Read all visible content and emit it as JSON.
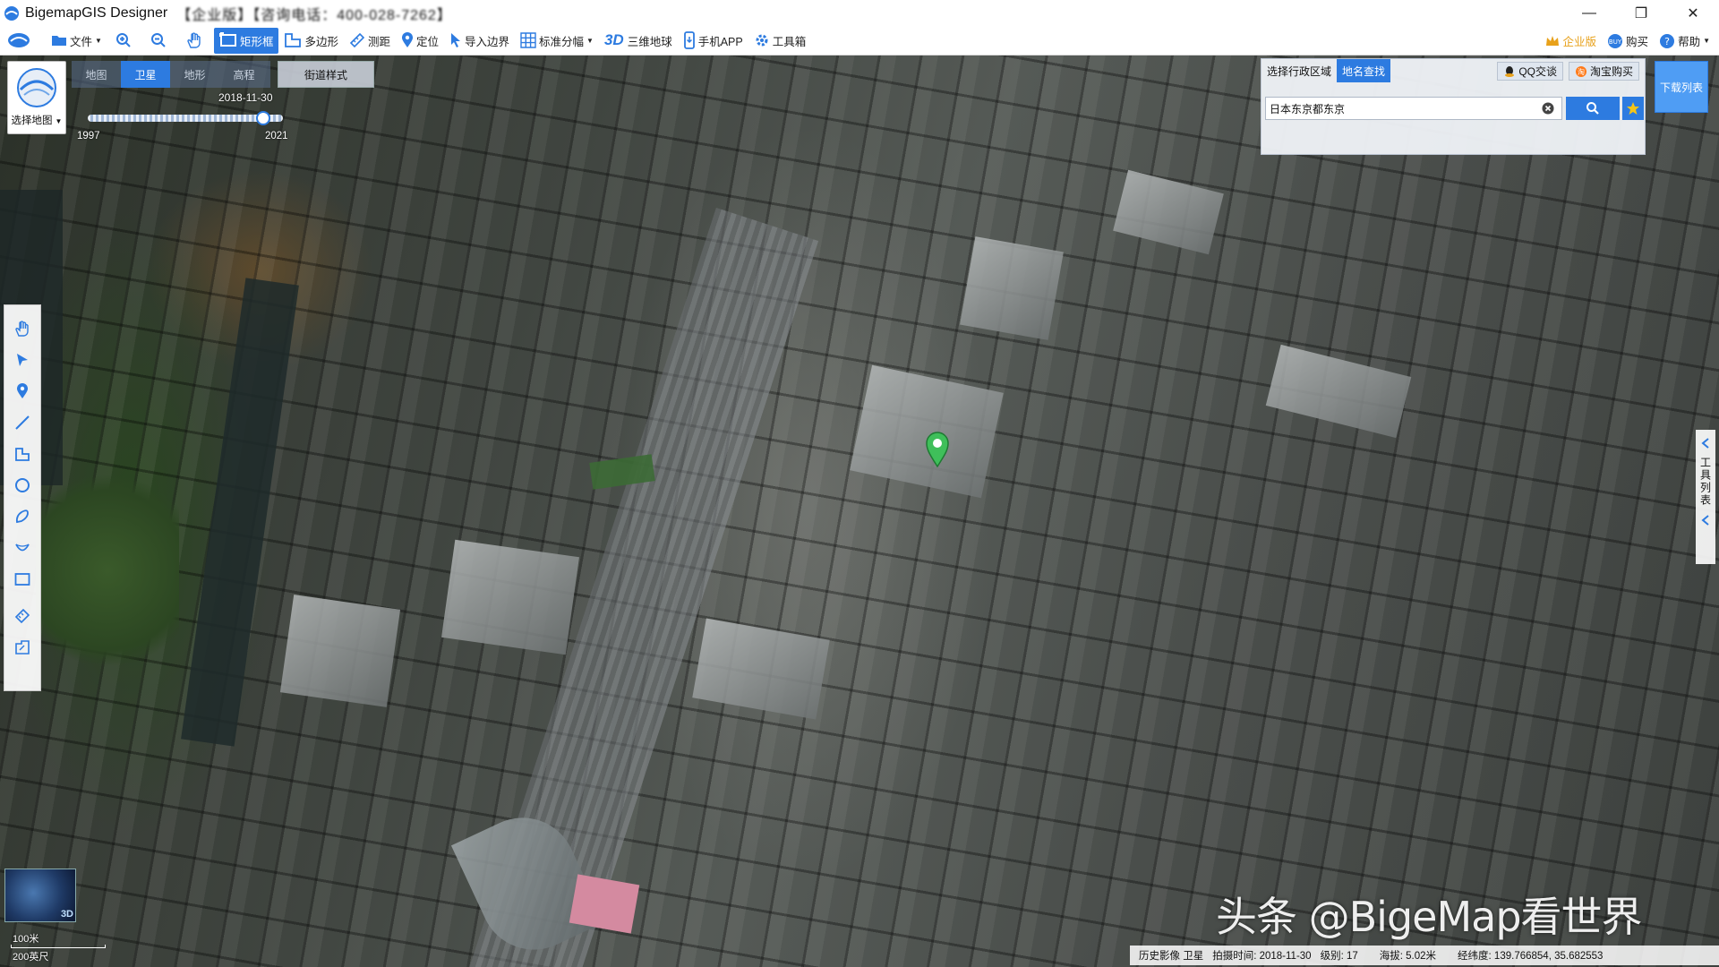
{
  "window": {
    "title": "BigemapGIS Designer",
    "title_extra": "【企业版】【咨询电话：400-028-7262】",
    "controls": [
      "—",
      "❐",
      "✕"
    ]
  },
  "toolbar": {
    "file": "文件",
    "rect_select": "矩形框",
    "polygon": "多边形",
    "measure": "测距",
    "locate": "定位",
    "import_boundary": "导入边界",
    "standard_tiles": "标准分幅",
    "three_d": "3D",
    "globe3d": "三维地球",
    "mobile_app": "手机APP",
    "toolbox": "工具箱",
    "enterprise": "企业版",
    "buy": "购买",
    "help": "帮助"
  },
  "basemap": {
    "select_label": "选择地图",
    "types": [
      {
        "label": "地图",
        "active": false
      },
      {
        "label": "卫星",
        "active": true
      },
      {
        "label": "地形",
        "active": false
      },
      {
        "label": "高程",
        "active": false
      }
    ],
    "street_style": "街道样式"
  },
  "timeline": {
    "current_date": "2018-11-30",
    "start_year": "1997",
    "end_year": "2021"
  },
  "search_panel": {
    "tabs": [
      {
        "label": "选择行政区域",
        "active": false
      },
      {
        "label": "地名查找",
        "active": true
      }
    ],
    "qq": "QQ交谈",
    "taobao": "淘宝购买",
    "query": "日本东京都东京",
    "download_list": "下载列表"
  },
  "right_tool_list": "工具列表",
  "overview": {
    "badge": "3D"
  },
  "scale": {
    "metric": "100米",
    "imperial": "200英尺"
  },
  "watermark": "头条 @BigeMap看世界",
  "status": {
    "layer": "历史影像 卫星",
    "capture_time": "拍摄时间: 2018-11-30",
    "level": "级别:  17",
    "altitude": "海拔: 5.02米",
    "coords": "经纬度:  139.766854, 35.682553"
  },
  "colors": {
    "accent": "#2d7be0",
    "enterprise": "#e8a11a",
    "pin": "#3fbf5a"
  }
}
